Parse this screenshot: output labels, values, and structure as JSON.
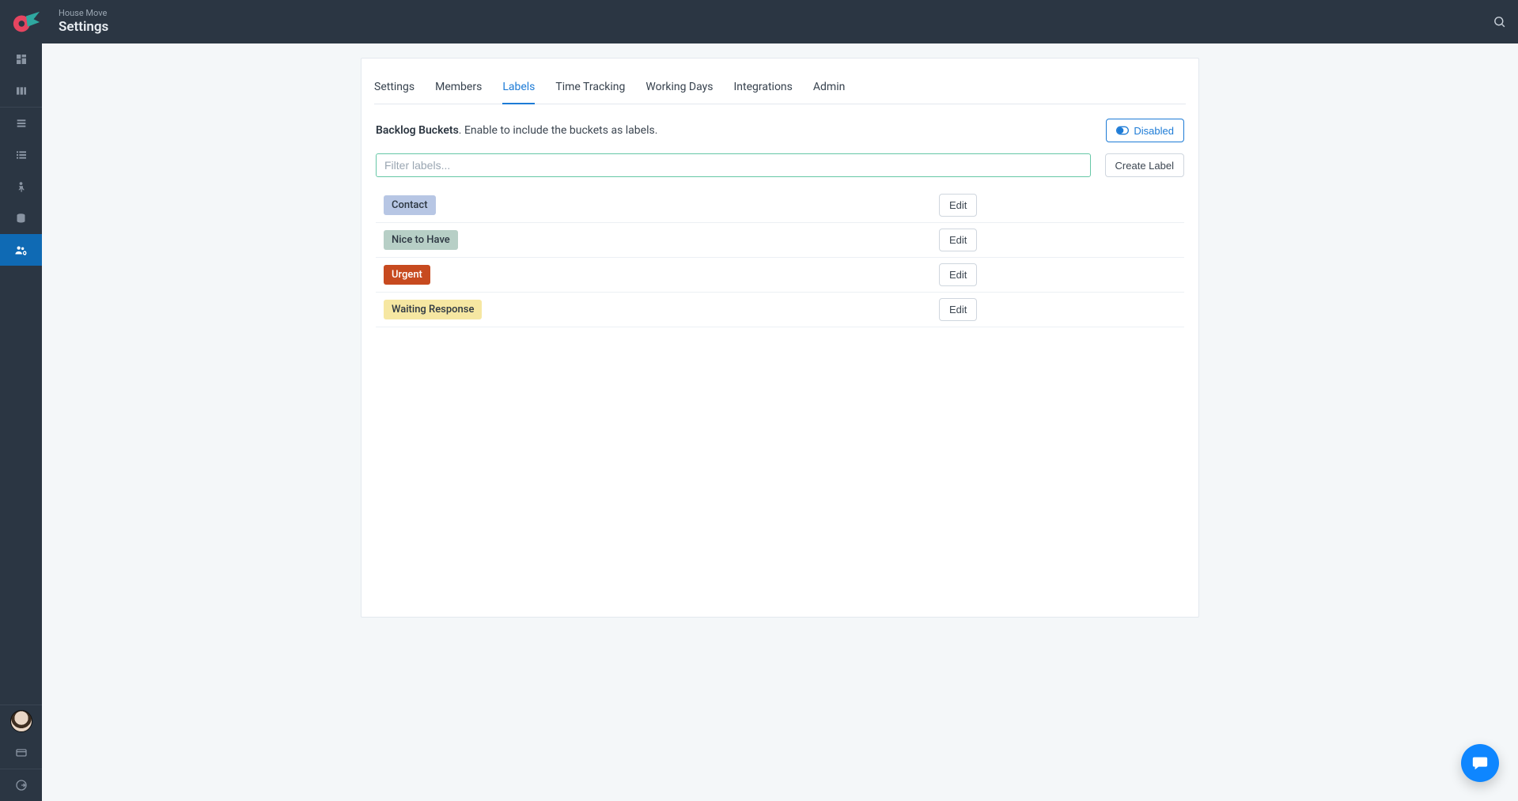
{
  "colors": {
    "accent": "#1d7bd6",
    "topbar": "#2b3643",
    "inputBorder": "#66c7a6"
  },
  "header": {
    "breadcrumb": "House Move",
    "title": "Settings"
  },
  "tabs": [
    {
      "label": "Settings",
      "active": false
    },
    {
      "label": "Members",
      "active": false
    },
    {
      "label": "Labels",
      "active": true
    },
    {
      "label": "Time Tracking",
      "active": false
    },
    {
      "label": "Working Days",
      "active": false
    },
    {
      "label": "Integrations",
      "active": false
    },
    {
      "label": "Admin",
      "active": false
    }
  ],
  "backlog": {
    "title": "Backlog Buckets",
    "description": ". Enable to include the buckets as labels.",
    "toggle_label": "Disabled"
  },
  "filter": {
    "placeholder": "Filter labels...",
    "value": ""
  },
  "create_label_button": "Create Label",
  "edit_button": "Edit",
  "labels": [
    {
      "name": "Contact",
      "bg": "#b7c6e4",
      "fg": "#2d3742"
    },
    {
      "name": "Nice to Have",
      "bg": "#b7cfc6",
      "fg": "#2d3742"
    },
    {
      "name": "Urgent",
      "bg": "#c74a1f",
      "fg": "#ffffff"
    },
    {
      "name": "Waiting Response",
      "bg": "#f6e7a2",
      "fg": "#2d3742"
    }
  ]
}
